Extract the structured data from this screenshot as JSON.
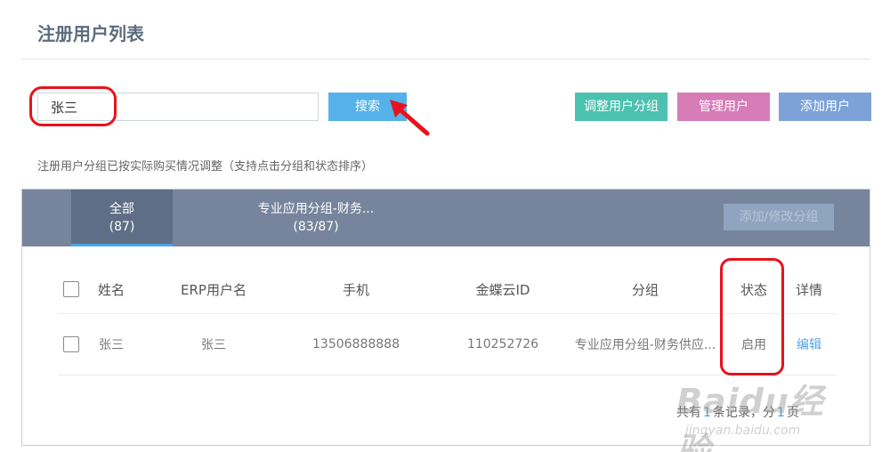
{
  "page": {
    "title": "注册用户列表"
  },
  "search": {
    "value": "张三",
    "button_label": "搜索"
  },
  "actions": {
    "regroup_label": "调整用户分组",
    "manage_label": "管理用户",
    "add_label": "添加用户"
  },
  "hint": "注册用户分组已按实际购买情况调整（支持点击分组和状态排序）",
  "groups": {
    "tabs": [
      {
        "label": "全部",
        "count": "(87)",
        "active": true
      },
      {
        "label": "专业应用分组-财务...",
        "count": "(83/87)",
        "active": false
      }
    ],
    "edit_button_label": "添加/修改分组"
  },
  "table": {
    "headers": {
      "name": "姓名",
      "erp_username": "ERP用户名",
      "phone": "手机",
      "kingdee_id": "金蝶云ID",
      "group": "分组",
      "status": "状态",
      "detail": "详情"
    },
    "rows": [
      {
        "name": "张三",
        "erp_username": "张三",
        "phone": "13506888888",
        "kingdee_id": "110252726",
        "group": "专业应用分组-财务供应...",
        "status": "启用",
        "detail": "编辑"
      }
    ]
  },
  "pagination": {
    "prefix": "共有",
    "records": "1",
    "middle": "条记录，分",
    "pages": "1",
    "suffix": "页"
  },
  "watermark": {
    "main": "Baidu经验",
    "sub": "jingyan.baidu.com",
    "color": "#969696"
  },
  "colors": {
    "search_button": "#55b1ea",
    "regroup_button": "#4bc1b0",
    "manage_button": "#d67cb7",
    "add_button": "#7ca2d8",
    "tab_bar": "#76859c",
    "active_tab_underline": "#47a6e9",
    "annotation": "#e8121c",
    "link": "#55a4e0"
  }
}
